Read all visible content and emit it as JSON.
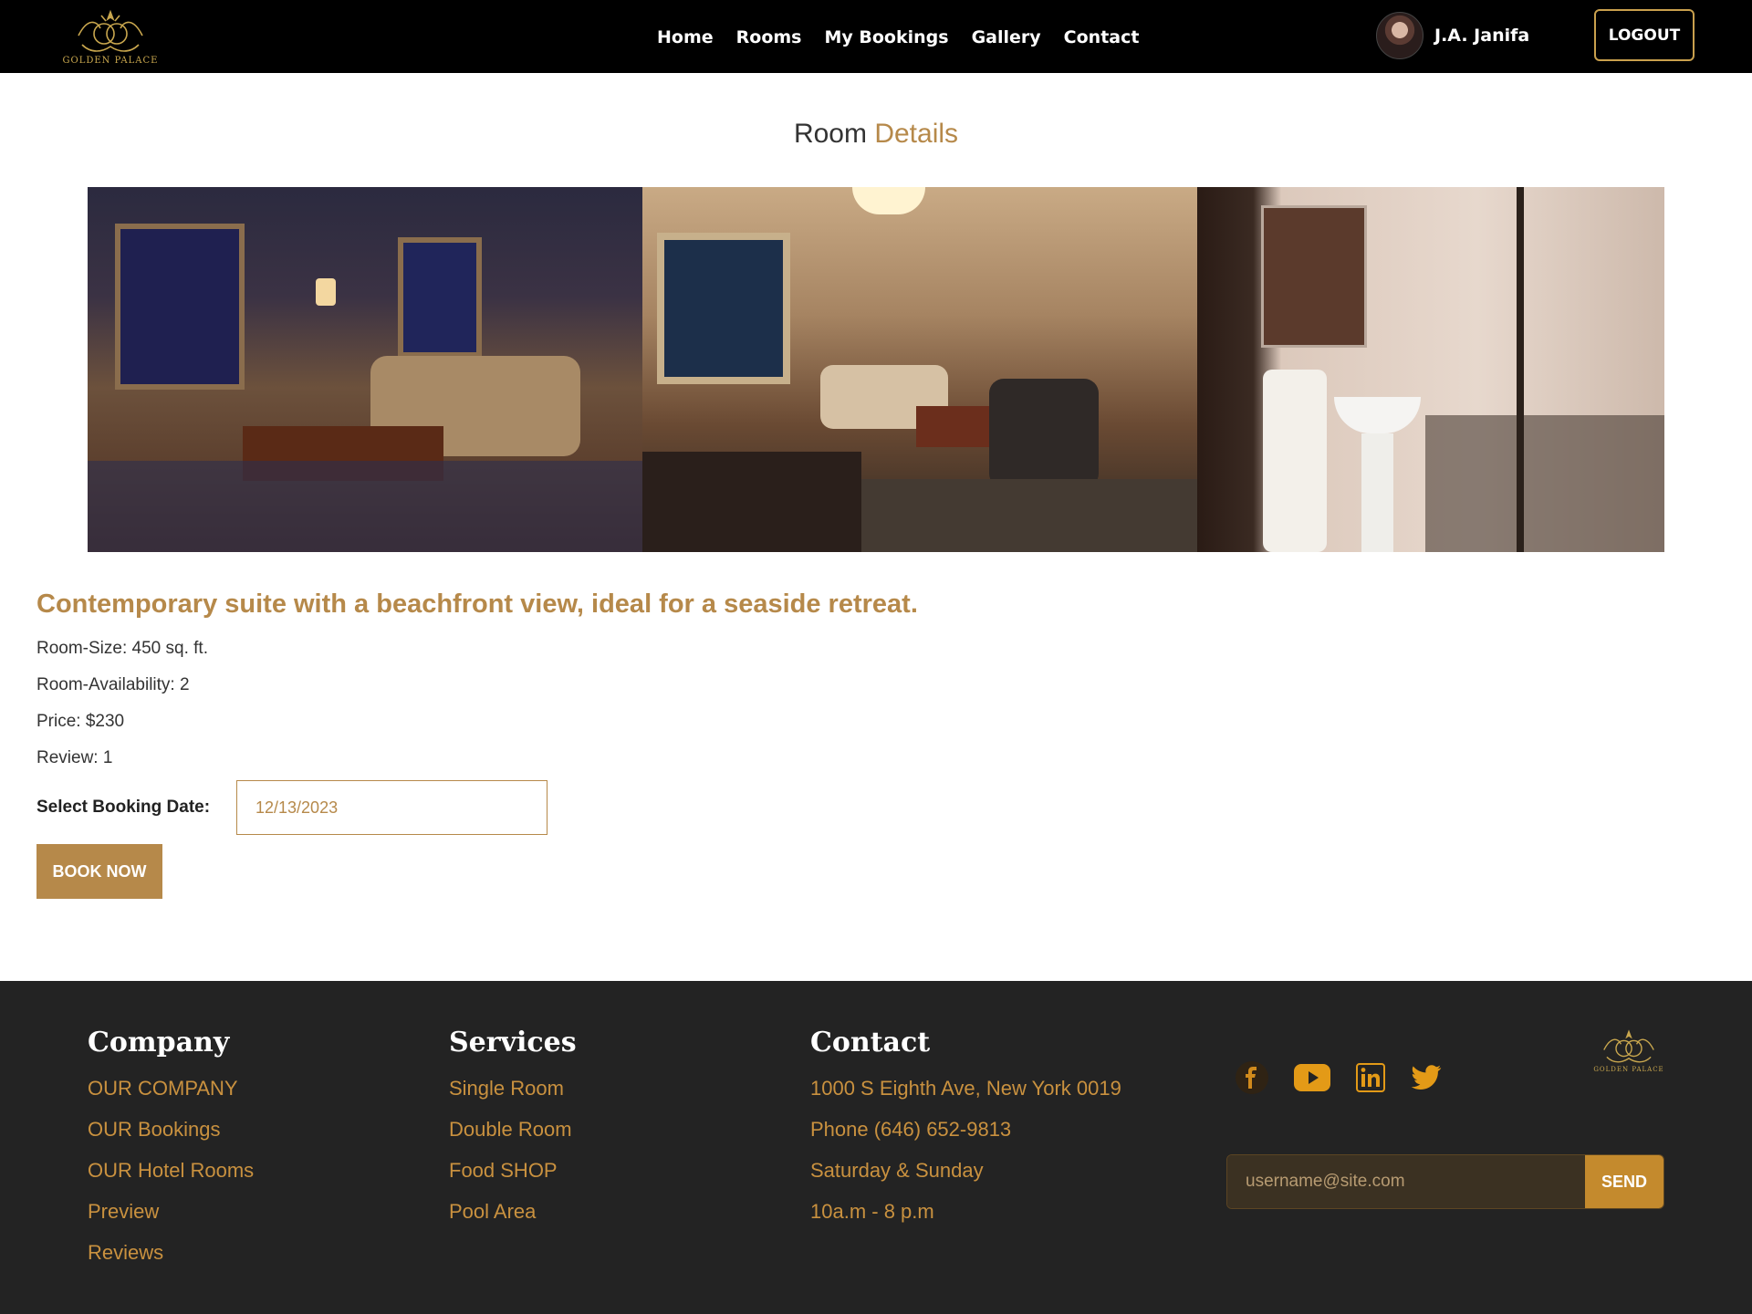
{
  "brand": {
    "name": "GOLDEN PALACE",
    "icon": "palace-crest-logo"
  },
  "nav": {
    "items": [
      {
        "label": "Home"
      },
      {
        "label": "Rooms"
      },
      {
        "label": "My Bookings"
      },
      {
        "label": "Gallery"
      },
      {
        "label": "Contact"
      }
    ]
  },
  "user": {
    "name": "J.A. Janifa",
    "logout_label": "LOGOUT"
  },
  "page": {
    "title_main": "Room",
    "title_accent": "Details"
  },
  "room": {
    "heading": "Contemporary suite with a beachfront view, ideal for a seaside retreat.",
    "size": "Room-Size: 450 sq. ft.",
    "availability": "Room-Availability: 2",
    "price": "Price: $230",
    "review": "Review: 1"
  },
  "booking": {
    "label": "Select Booking Date:",
    "date_value": "12/13/2023",
    "button_label": "BOOK NOW"
  },
  "footer": {
    "company": {
      "heading": "Company",
      "links": [
        "OUR COMPANY",
        "OUR Bookings",
        "OUR Hotel Rooms",
        "Preview",
        "Reviews"
      ]
    },
    "services": {
      "heading": "Services",
      "links": [
        "Single Room",
        "Double Room",
        "Food SHOP",
        "Pool Area"
      ]
    },
    "contact": {
      "heading": "Contact",
      "lines": [
        "1000 S Eighth Ave, New York 0019",
        "Phone (646) 652-9813",
        "Saturday & Sunday",
        "10a.m - 8 p.m"
      ]
    },
    "social_icons": [
      "facebook-icon",
      "youtube-icon",
      "linkedin-icon",
      "twitter-icon"
    ],
    "subscribe": {
      "placeholder": "username@site.com",
      "button_label": "SEND"
    }
  },
  "colors": {
    "accent": "#b6894a",
    "header_bg": "#000000",
    "footer_bg": "#232323",
    "footer_link": "#c9913f"
  }
}
